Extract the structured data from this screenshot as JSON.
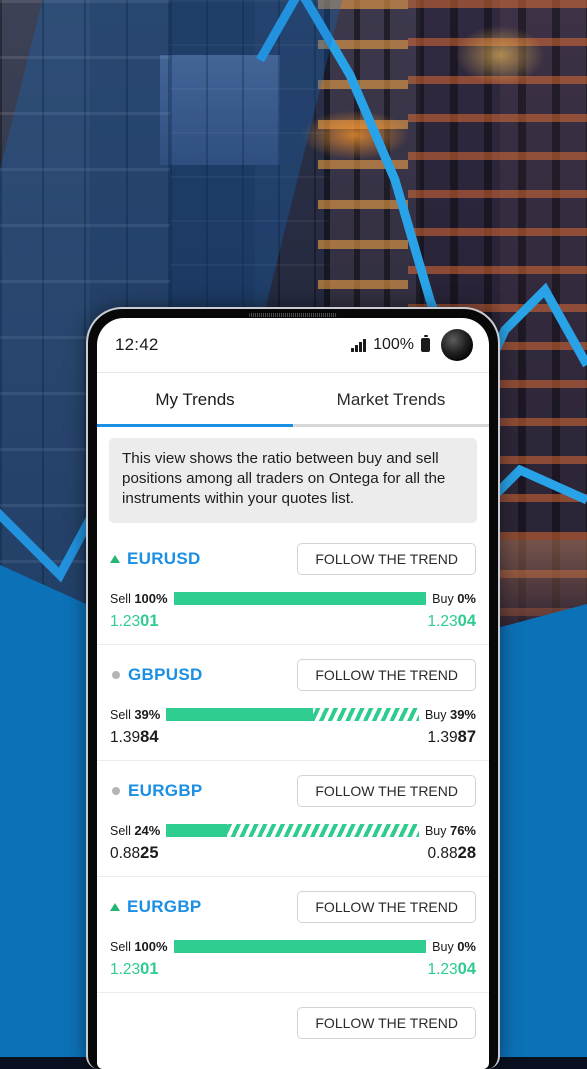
{
  "background": {
    "scene": "night-city-skyline",
    "accent_blue": "#0c72b8",
    "line_blue": "#29a3e8"
  },
  "phone": {
    "status_bar": {
      "time": "12:42",
      "battery_percent": "100%",
      "signal_icon": "signal-bars-icon",
      "battery_icon": "battery-full-icon",
      "camera_icon": "front-camera-punch-hole"
    },
    "tabs": [
      {
        "label": "My Trends",
        "active": true
      },
      {
        "label": "Market Trends",
        "active": false
      }
    ],
    "banner": {
      "text": "This view shows the ratio between buy and sell positions among all traders on Ontega for all the instruments within your quotes list."
    },
    "follow_button_label": "FOLLOW THE TREND",
    "sell_label": "Sell",
    "buy_label": "Buy",
    "rows": [
      {
        "symbol": "EURUSD",
        "indicator": "up-triangle",
        "sell_percent": "100%",
        "buy_percent": "0%",
        "fill_percent": 100,
        "sell_price_head": "1.23",
        "sell_price_tail": "01",
        "buy_price_head": "1.23",
        "buy_price_tail": "04",
        "price_color": "green"
      },
      {
        "symbol": "GBPUSD",
        "indicator": "neutral-dot",
        "sell_percent": "39%",
        "buy_percent": "39%",
        "fill_percent": 58,
        "sell_price_head": "1.39",
        "sell_price_tail": "84",
        "buy_price_head": "1.39",
        "buy_price_tail": "87",
        "price_color": "black"
      },
      {
        "symbol": "EURGBP",
        "indicator": "neutral-dot",
        "sell_percent": "24%",
        "buy_percent": "76%",
        "fill_percent": 24,
        "sell_price_head": "0.88",
        "sell_price_tail": "25",
        "buy_price_head": "0.88",
        "buy_price_tail": "28",
        "price_color": "black"
      },
      {
        "symbol": "EURGBP",
        "indicator": "up-triangle",
        "sell_percent": "100%",
        "buy_percent": "0%",
        "fill_percent": 100,
        "sell_price_head": "1.23",
        "sell_price_tail": "01",
        "buy_price_head": "1.23",
        "buy_price_tail": "04",
        "price_color": "green"
      }
    ]
  }
}
